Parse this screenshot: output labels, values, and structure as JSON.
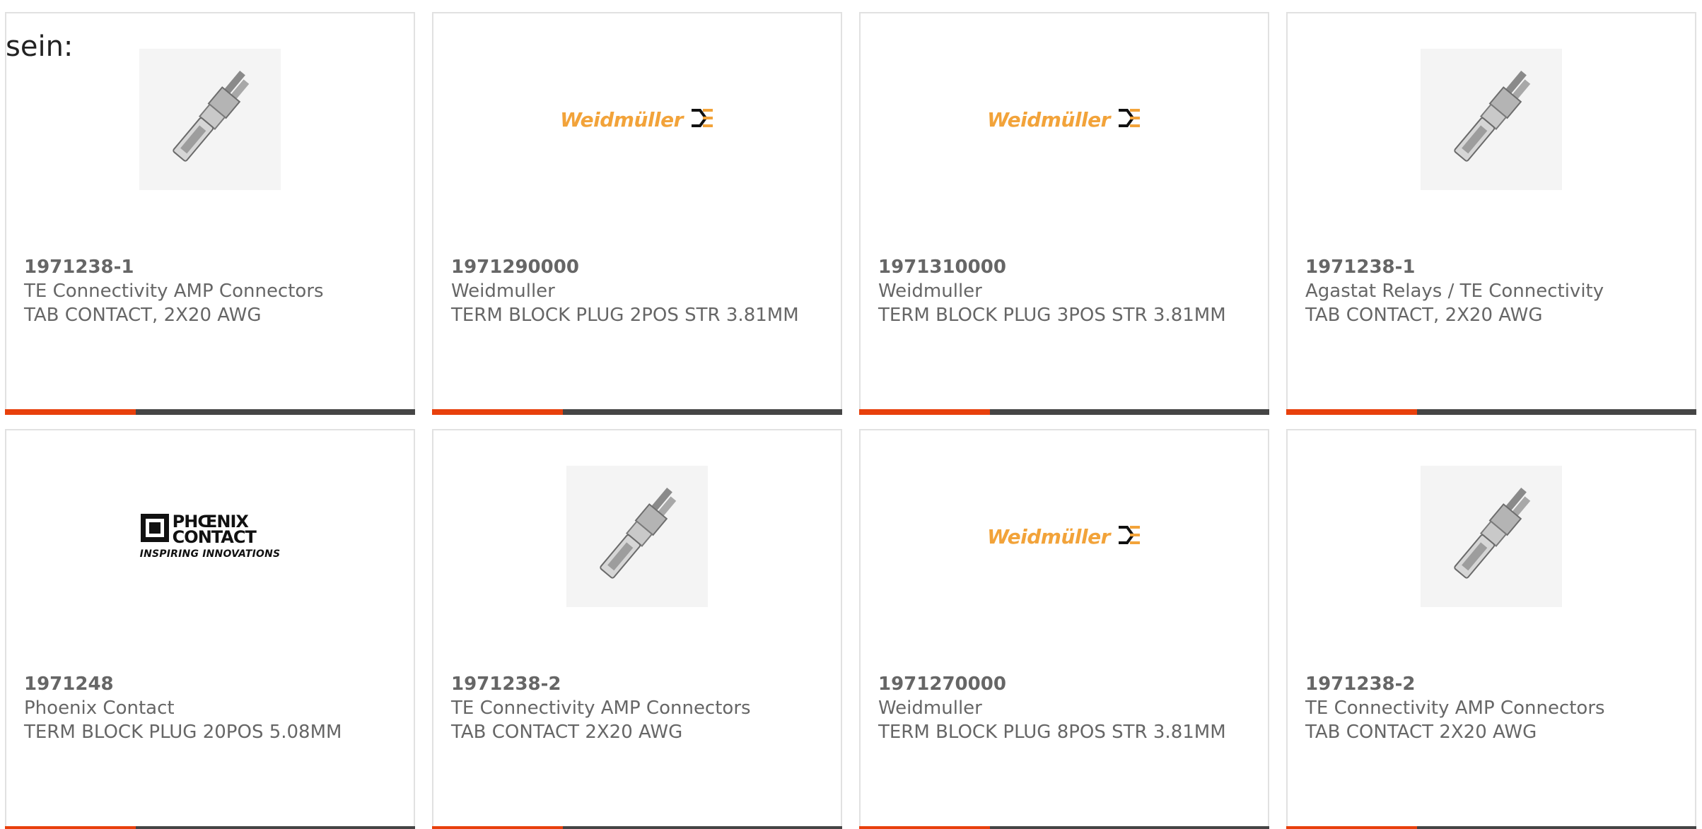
{
  "intro_text": "sein:",
  "colors": {
    "accent_bar": "#e8400c",
    "base_bar": "#454545",
    "weidmuller_orange": "#f2a33a"
  },
  "cards": [
    {
      "image": "terminal-contact-photo",
      "part_number": "1971238-1",
      "manufacturer": "TE Connectivity AMP Connectors",
      "description": "TAB CONTACT, 2X20 AWG"
    },
    {
      "image": "weidmuller-logo",
      "logo_text": "Weidmüller",
      "part_number": "1971290000",
      "manufacturer": "Weidmuller",
      "description": "TERM BLOCK PLUG 2POS STR 3.81MM"
    },
    {
      "image": "weidmuller-logo",
      "logo_text": "Weidmüller",
      "part_number": "1971310000",
      "manufacturer": "Weidmuller",
      "description": "TERM BLOCK PLUG 3POS STR 3.81MM"
    },
    {
      "image": "terminal-contact-photo",
      "part_number": "1971238-1",
      "manufacturer": "Agastat Relays / TE Connectivity",
      "description": "TAB CONTACT, 2X20 AWG"
    },
    {
      "image": "phoenix-contact-logo",
      "logo_line1": "PHŒNIX",
      "logo_line2": "CONTACT",
      "logo_tagline": "INSPIRING INNOVATIONS",
      "part_number": "1971248",
      "manufacturer": "Phoenix Contact",
      "description": "TERM BLOCK PLUG 20POS 5.08MM"
    },
    {
      "image": "terminal-contact-photo",
      "part_number": "1971238-2",
      "manufacturer": "TE Connectivity AMP Connectors",
      "description": "TAB CONTACT 2X20 AWG"
    },
    {
      "image": "weidmuller-logo",
      "logo_text": "Weidmüller",
      "part_number": "1971270000",
      "manufacturer": "Weidmuller",
      "description": "TERM BLOCK PLUG 8POS STR 3.81MM"
    },
    {
      "image": "terminal-contact-photo",
      "part_number": "1971238-2",
      "manufacturer": "TE Connectivity AMP Connectors",
      "description": "TAB CONTACT 2X20 AWG"
    }
  ]
}
